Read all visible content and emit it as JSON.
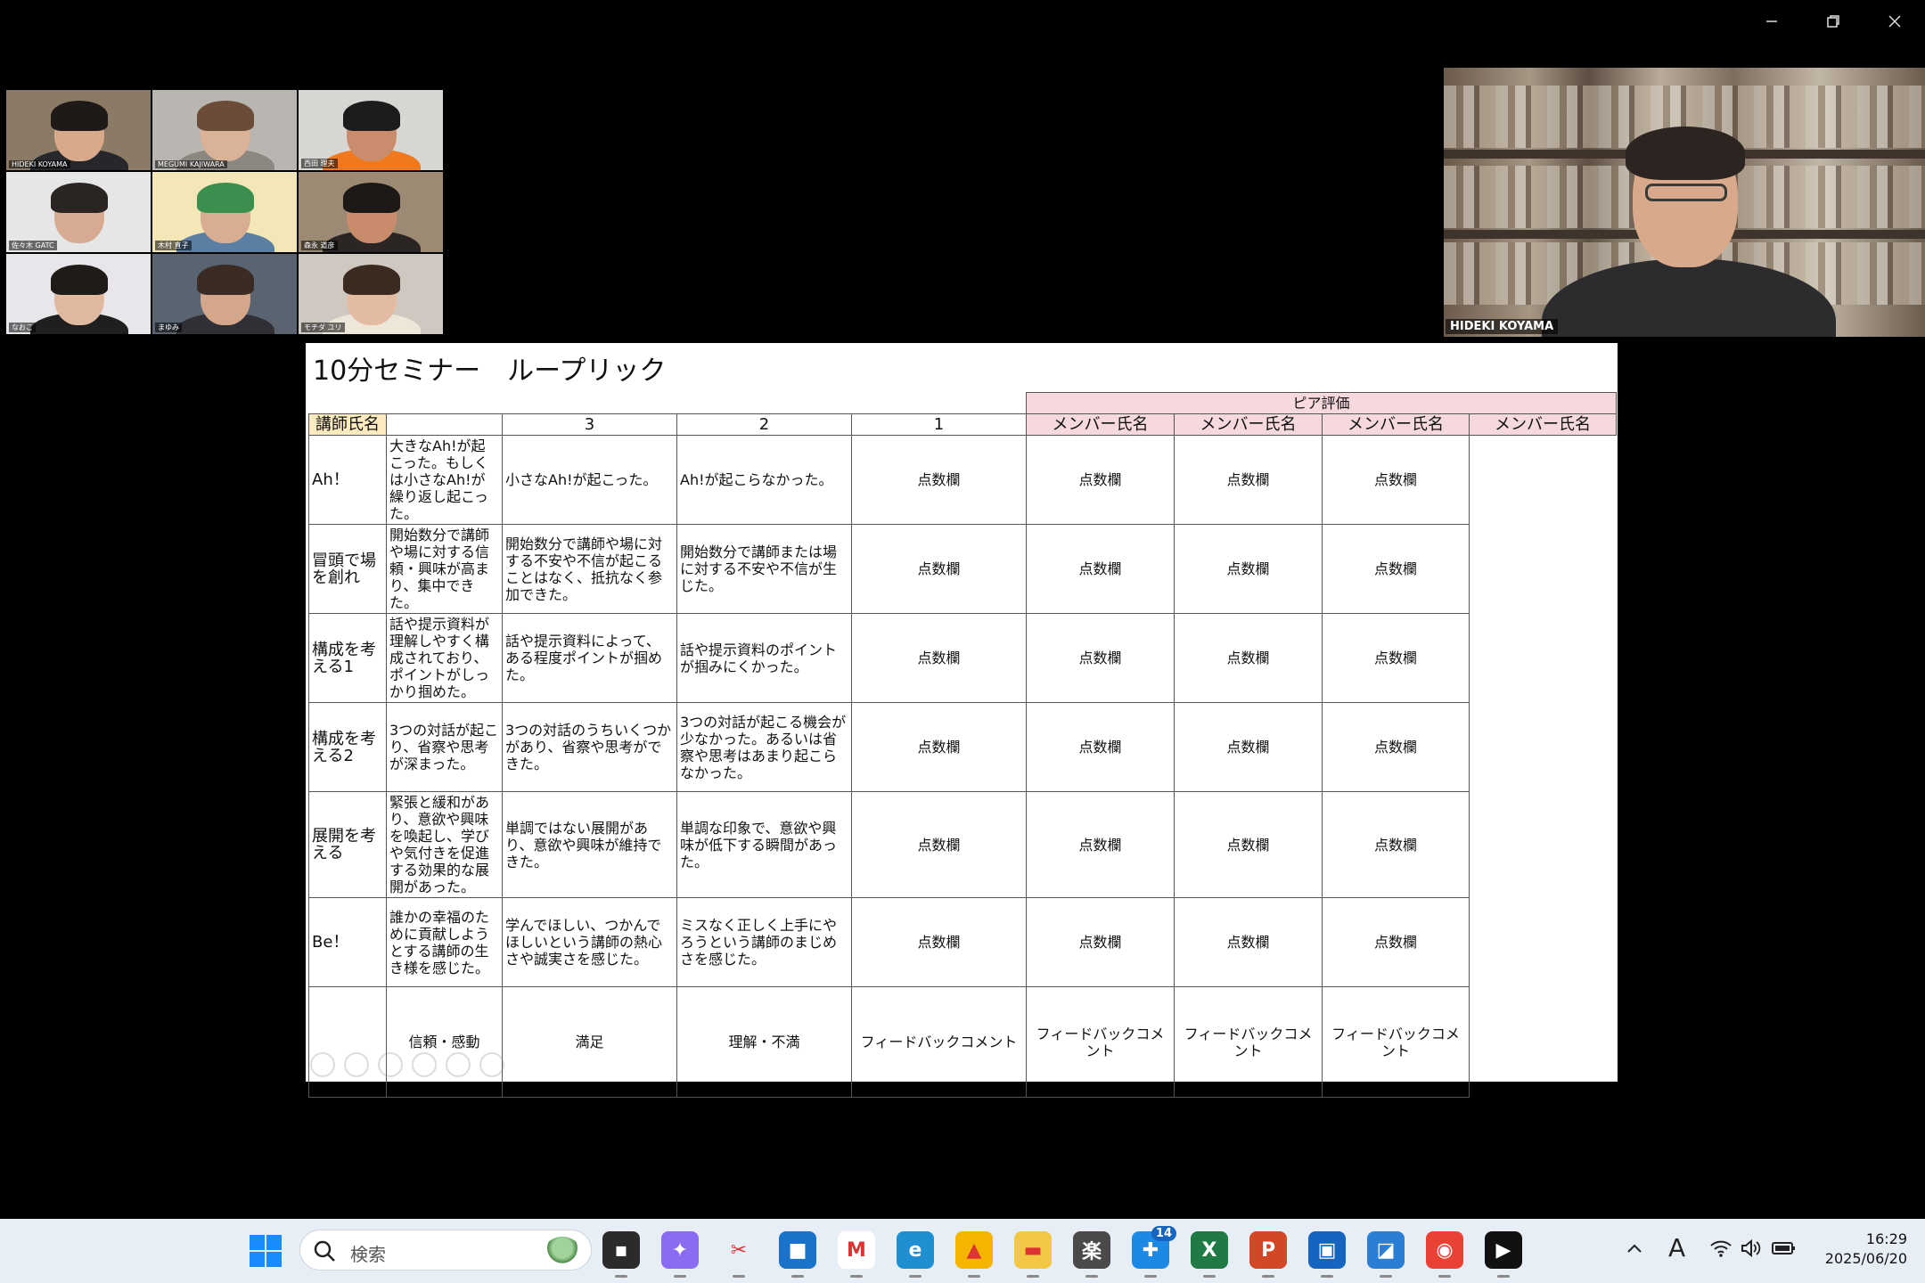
{
  "window": {
    "controls": [
      "minimize-icon",
      "restore-icon",
      "close-icon"
    ]
  },
  "gallery": [
    {
      "name": "HIDEKI KOYAMA",
      "bg": "#8a7a66",
      "skin": "#d8a98b",
      "hair": "#1e1a18",
      "shirt": "#25272b"
    },
    {
      "name": "MEGUMI KAJIWARA",
      "bg": "#b9b6b2",
      "skin": "#d9b297",
      "hair": "#6b4c39",
      "shirt": "#8c8680"
    },
    {
      "name": "西田 理夫",
      "bg": "#d8d6d2",
      "skin": "#c98d6e",
      "hair": "#1c1c1c",
      "shirt": "#f0791e"
    },
    {
      "name": "佐々木 GATC",
      "bg": "#e6e6e6",
      "skin": "#d6ab92",
      "hair": "#2a2522",
      "shirt": "#e6e6e6"
    },
    {
      "name": "木村 直子",
      "bg": "#f3e7b7",
      "skin": "#d8ad92",
      "hair": "#3b8f4e",
      "shirt": "#5a7fa3"
    },
    {
      "name": "森永 道彦",
      "bg": "#9d8a74",
      "skin": "#c88c6c",
      "hair": "#1c1916",
      "shirt": "#2b2624"
    },
    {
      "name": "なおこ",
      "bg": "#e8e6ea",
      "skin": "#e0b9a0",
      "hair": "#1f1b19",
      "shirt": "#1f1f1f"
    },
    {
      "name": "まゆみ",
      "bg": "#5a6470",
      "skin": "#d4a68c",
      "hair": "#3a2c24",
      "shirt": "#2f2f35"
    },
    {
      "name": "モチダ ユリ",
      "bg": "#cfc8c0",
      "skin": "#e2bba2",
      "hair": "#3a2a20",
      "shirt": "#efe6da"
    }
  ],
  "speaker": {
    "name": "HIDEKI KOYAMA"
  },
  "slide": {
    "title": "10分セミナー　ループリック",
    "peer_header": "ピア評価",
    "teacher_label": "講師氏名",
    "score_headers": [
      "3",
      "2",
      "1"
    ],
    "member_headers": [
      "メンバー氏名",
      "メンバー氏名",
      "メンバー氏名",
      "メンバー氏名"
    ],
    "rows": [
      {
        "label": "Ah！",
        "c3": "大きなAh!が起こった。もしくは小さなAh!が繰り返し起こった。",
        "c2": "小さなAh!が起こった。",
        "c1": "Ah!が起こらなかった。"
      },
      {
        "label": "冒頭で場を創れ",
        "c3": "開始数分で講師や場に対する信頼・興味が高まり、集中できた。",
        "c2": "開始数分で講師や場に対する不安や不信が起こることはなく、抵抗なく参加できた。",
        "c1": "開始数分で講師または場に対する不安や不信が生じた。"
      },
      {
        "label": "構成を考える1",
        "c3": "話や提示資料が理解しやすく構成されており、ポイントがしっかり掴めた。",
        "c2": "話や提示資料によって、ある程度ポイントが掴めた。",
        "c1": "話や提示資料のポイントが掴みにくかった。"
      },
      {
        "label": "構成を考える2",
        "c3": "3つの対話が起こり、省察や思考が深まった。",
        "c2": "3つの対話のうちいくつかがあり、省察や思考ができた。",
        "c1": "3つの対話が起こる機会が少なかった。あるいは省察や思考はあまり起こらなかった。"
      },
      {
        "label": "展開を考える",
        "c3": "緊張と緩和があり、意欲や興味を喚起し、学びや気付きを促進する効果的な展開があった。",
        "c2": "単調ではない展開があり、意欲や興味が維持できた。",
        "c1": "単調な印象で、意欲や興味が低下する瞬間があった。"
      },
      {
        "label": "Be！",
        "c3": "誰かの幸福のために貢献しようとする講師の生き様を感じた。",
        "c2": "学んでほしい、つかんでほしいという講師の熱心さや誠実さを感じた。",
        "c1": "ミスなく正しく上手にやろうという講師のまじめさを感じた。"
      }
    ],
    "score_cell": "点数欄",
    "footer": {
      "c3": "信頼・感動",
      "c2": "満足",
      "c1": "理解・不満",
      "feedback": "フィードバックコメント"
    }
  },
  "taskbar": {
    "search_placeholder": "検索",
    "apps": [
      {
        "name": "file-explorer-dark-icon",
        "color": "#2b2b2b",
        "glyph": "▪"
      },
      {
        "name": "copilot-icon",
        "color": "#8a6cf0",
        "glyph": "✦"
      },
      {
        "name": "snipping-tool-icon",
        "color": "#e8eef6",
        "glyph": "✂"
      },
      {
        "name": "microsoft-store-icon",
        "color": "#1a73c9",
        "glyph": "■"
      },
      {
        "name": "gmail-icon",
        "color": "#ffffff",
        "glyph": "M"
      },
      {
        "name": "edge-icon",
        "color": "#1f8fd1",
        "glyph": "e"
      },
      {
        "name": "google-drive-icon",
        "color": "#f5b400",
        "glyph": "▲"
      },
      {
        "name": "folder-icon",
        "color": "#f2c744",
        "glyph": "▬"
      },
      {
        "name": "app-kanji-icon",
        "color": "#4a4a4a",
        "glyph": "楽"
      },
      {
        "name": "messaging-icon",
        "color": "#1e88e5",
        "glyph": "✚",
        "badge": "14"
      },
      {
        "name": "excel-icon",
        "color": "#1f7a45",
        "glyph": "X"
      },
      {
        "name": "powerpoint-icon",
        "color": "#d24726",
        "glyph": "P"
      },
      {
        "name": "remote-desktop-icon",
        "color": "#1565c0",
        "glyph": "▣"
      },
      {
        "name": "photos-icon",
        "color": "#2a7fd4",
        "glyph": "◪"
      },
      {
        "name": "chrome-icon",
        "color": "#e94235",
        "glyph": "◉"
      },
      {
        "name": "media-player-icon",
        "color": "#111111",
        "glyph": "▶"
      }
    ],
    "tray": [
      "chevron-up-icon",
      "ime-icon",
      "wifi-icon",
      "volume-icon",
      "battery-icon"
    ],
    "ime_label": "A",
    "time": "16:29",
    "date": "2025/06/20"
  }
}
